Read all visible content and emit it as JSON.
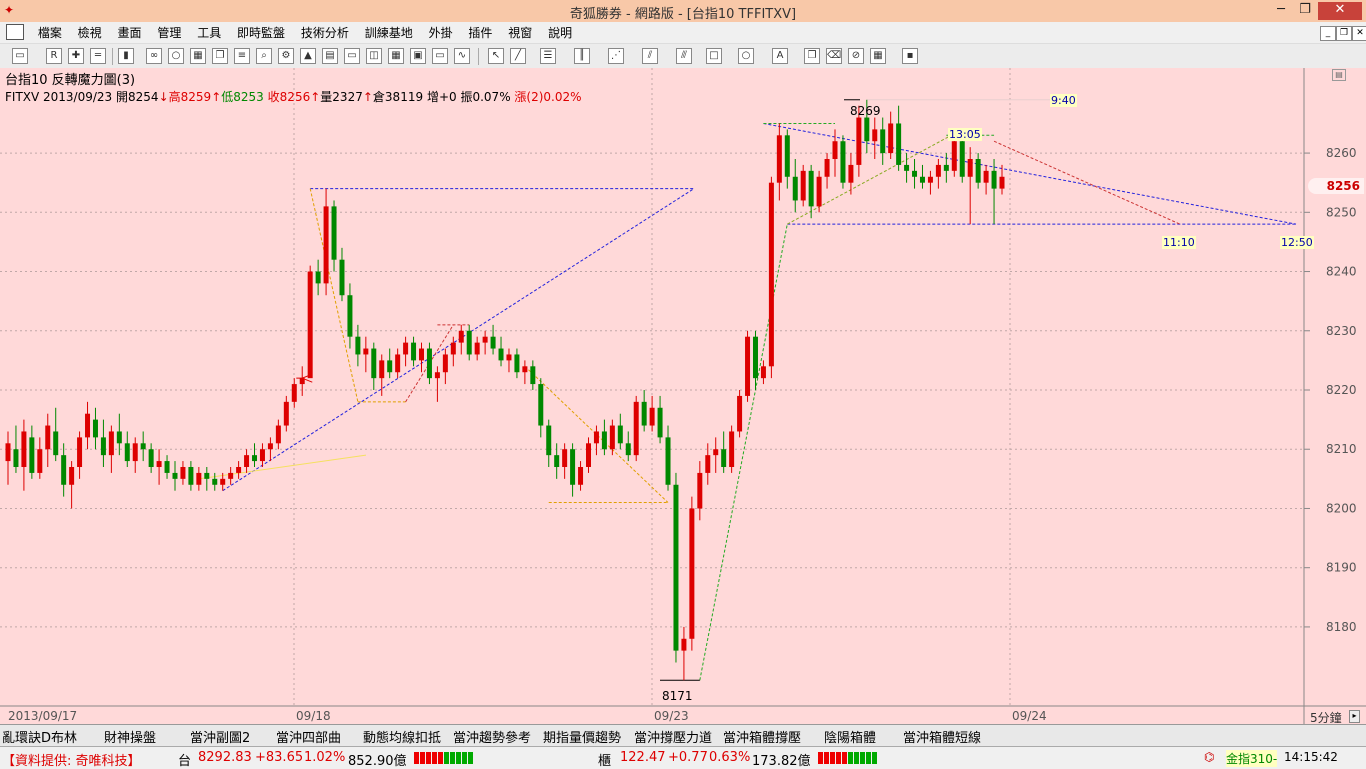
{
  "window": {
    "title": "奇狐勝券 - 網路版 - [台指10 TFFITXV]"
  },
  "menu": [
    "檔案",
    "檢視",
    "畫面",
    "管理",
    "工具",
    "即時監盤",
    "技術分析",
    "訓練基地",
    "外掛",
    "插件",
    "視窗",
    "說明"
  ],
  "chart": {
    "title": "台指10 反轉魔力圖(3)",
    "info": {
      "symbol_date": "FITXV 2013/09/23",
      "open_label": "開",
      "open": "8254",
      "high_label": "高",
      "high": "8259",
      "low_label": "低",
      "low": "8253",
      "close_label": "收",
      "close": "8256",
      "vol_label": "量",
      "vol": "2327",
      "oi_label": "倉",
      "oi": "38119",
      "inc": "增+0",
      "amp": "振0.07%",
      "chg_label": "漲(2)",
      "chg": "0.02%"
    },
    "price_tag": "8256",
    "period": "5分鐘",
    "marks": {
      "high": "8269",
      "low": "8171"
    },
    "time_labels": [
      "9:40",
      "13:05",
      "11:10",
      "12:50"
    ],
    "date_labels": [
      "2013/09/17",
      "09/18",
      "09/23",
      "09/24"
    ],
    "colors": {
      "background": "#ffd9d9",
      "up": "#dd0000",
      "down": "#008800"
    }
  },
  "chart_data": {
    "type": "candlestick",
    "title": "台指10 反轉魔力圖(3)",
    "period": "5分鐘",
    "ylim": [
      8168,
      8272
    ],
    "yticks": [
      8180,
      8190,
      8200,
      8210,
      8220,
      8230,
      8240,
      8250,
      8260
    ],
    "series": [
      {
        "ohlc": [
          [
            8208,
            8213,
            8204,
            8211
          ],
          [
            8210,
            8214,
            8206,
            8207
          ],
          [
            8207,
            8215,
            8203,
            8213
          ],
          [
            8212,
            8214,
            8205,
            8206
          ],
          [
            8206,
            8212,
            8205,
            8210
          ],
          [
            8210,
            8216,
            8207,
            8214
          ],
          [
            8213,
            8217,
            8208,
            8209
          ],
          [
            8209,
            8211,
            8202,
            8204
          ],
          [
            8204,
            8208,
            8200,
            8207
          ],
          [
            8207,
            8213,
            8205,
            8212
          ],
          [
            8212,
            8218,
            8210,
            8216
          ],
          [
            8215,
            8217,
            8210,
            8212
          ],
          [
            8212,
            8215,
            8207,
            8209
          ],
          [
            8209,
            8214,
            8206,
            8213
          ],
          [
            8213,
            8216,
            8209,
            8211
          ],
          [
            8211,
            8213,
            8207,
            8208
          ],
          [
            8208,
            8212,
            8206,
            8211
          ],
          [
            8211,
            8213,
            8208,
            8210
          ],
          [
            8210,
            8211,
            8206,
            8207
          ],
          [
            8207,
            8210,
            8204,
            8208
          ],
          [
            8208,
            8209,
            8205,
            8206
          ],
          [
            8206,
            8208,
            8203,
            8205
          ],
          [
            8205,
            8208,
            8204,
            8207
          ],
          [
            8207,
            8208,
            8203,
            8204
          ],
          [
            8204,
            8207,
            8203,
            8206
          ],
          [
            8206,
            8207,
            8203,
            8205
          ],
          [
            8205,
            8206,
            8203,
            8204
          ],
          [
            8204,
            8206,
            8203,
            8205
          ],
          [
            8205,
            8207,
            8204,
            8206
          ],
          [
            8206,
            8208,
            8205,
            8207
          ],
          [
            8207,
            8210,
            8206,
            8209
          ],
          [
            8209,
            8211,
            8207,
            8208
          ],
          [
            8208,
            8211,
            8207,
            8210
          ],
          [
            8210,
            8212,
            8208,
            8211
          ],
          [
            8211,
            8215,
            8210,
            8214
          ],
          [
            8214,
            8219,
            8213,
            8218
          ],
          [
            8218,
            8222,
            8217,
            8221
          ],
          [
            8221,
            8224,
            8219,
            8222
          ],
          [
            8222,
            8241,
            8233,
            8240
          ],
          [
            8240,
            8242,
            8236,
            8238
          ],
          [
            8238,
            8254,
            8236,
            8251
          ],
          [
            8251,
            8252,
            8240,
            8242
          ],
          [
            8242,
            8244,
            8235,
            8236
          ],
          [
            8236,
            8238,
            8227,
            8229
          ],
          [
            8229,
            8231,
            8224,
            8226
          ],
          [
            8226,
            8229,
            8223,
            8227
          ],
          [
            8227,
            8228,
            8220,
            8222
          ],
          [
            8222,
            8226,
            8219,
            8225
          ],
          [
            8225,
            8227,
            8222,
            8223
          ],
          [
            8223,
            8227,
            8222,
            8226
          ],
          [
            8226,
            8229,
            8224,
            8228
          ],
          [
            8228,
            8229,
            8224,
            8225
          ],
          [
            8225,
            8228,
            8223,
            8227
          ],
          [
            8227,
            8228,
            8221,
            8222
          ],
          [
            8222,
            8224,
            8218,
            8223
          ],
          [
            8223,
            8227,
            8221,
            8226
          ],
          [
            8226,
            8229,
            8224,
            8228
          ],
          [
            8228,
            8231,
            8226,
            8230
          ],
          [
            8230,
            8231,
            8225,
            8226
          ],
          [
            8226,
            8229,
            8225,
            8228
          ],
          [
            8228,
            8230,
            8226,
            8229
          ],
          [
            8229,
            8231,
            8226,
            8227
          ],
          [
            8227,
            8229,
            8224,
            8225
          ],
          [
            8225,
            8227,
            8223,
            8226
          ],
          [
            8226,
            8227,
            8222,
            8223
          ],
          [
            8223,
            8225,
            8221,
            8224
          ],
          [
            8224,
            8225,
            8220,
            8221
          ],
          [
            8221,
            8222,
            8212,
            8214
          ],
          [
            8214,
            8215,
            8207,
            8209
          ],
          [
            8209,
            8211,
            8205,
            8207
          ],
          [
            8207,
            8211,
            8205,
            8210
          ],
          [
            8210,
            8211,
            8202,
            8204
          ],
          [
            8204,
            8208,
            8203,
            8207
          ],
          [
            8207,
            8212,
            8206,
            8211
          ],
          [
            8211,
            8214,
            8209,
            8213
          ],
          [
            8213,
            8215,
            8209,
            8210
          ],
          [
            8210,
            8215,
            8209,
            8214
          ],
          [
            8214,
            8216,
            8210,
            8211
          ],
          [
            8211,
            8213,
            8208,
            8209
          ],
          [
            8209,
            8219,
            8208,
            8218
          ],
          [
            8218,
            8220,
            8213,
            8214
          ],
          [
            8214,
            8219,
            8213,
            8217
          ],
          [
            8217,
            8219,
            8211,
            8212
          ],
          [
            8212,
            8214,
            8203,
            8204
          ],
          [
            8204,
            8206,
            8174,
            8176
          ],
          [
            8176,
            8180,
            8171,
            8178
          ],
          [
            8178,
            8202,
            8176,
            8200
          ],
          [
            8200,
            8208,
            8198,
            8206
          ],
          [
            8206,
            8211,
            8204,
            8209
          ],
          [
            8209,
            8212,
            8206,
            8210
          ],
          [
            8210,
            8213,
            8206,
            8207
          ],
          [
            8207,
            8214,
            8206,
            8213
          ],
          [
            8213,
            8220,
            8212,
            8219
          ],
          [
            8219,
            8230,
            8218,
            8229
          ],
          [
            8229,
            8230,
            8220,
            8222
          ],
          [
            8222,
            8225,
            8221,
            8224
          ],
          [
            8224,
            8256,
            8222,
            8255
          ],
          [
            8255,
            8265,
            8252,
            8263
          ],
          [
            8263,
            8264,
            8254,
            8256
          ],
          [
            8256,
            8259,
            8250,
            8252
          ],
          [
            8252,
            8258,
            8251,
            8257
          ],
          [
            8257,
            8258,
            8249,
            8251
          ],
          [
            8251,
            8257,
            8250,
            8256
          ],
          [
            8256,
            8260,
            8254,
            8259
          ],
          [
            8259,
            8264,
            8256,
            8262
          ],
          [
            8262,
            8263,
            8254,
            8255
          ],
          [
            8255,
            8260,
            8253,
            8258
          ],
          [
            8258,
            8268,
            8256,
            8266
          ],
          [
            8266,
            8269,
            8260,
            8262
          ],
          [
            8262,
            8266,
            8259,
            8264
          ],
          [
            8264,
            8266,
            8258,
            8260
          ],
          [
            8260,
            8267,
            8259,
            8265
          ],
          [
            8265,
            8268,
            8257,
            8258
          ],
          [
            8258,
            8260,
            8255,
            8257
          ],
          [
            8257,
            8259,
            8254,
            8256
          ],
          [
            8256,
            8258,
            8254,
            8255
          ],
          [
            8255,
            8257,
            8253,
            8256
          ],
          [
            8256,
            8259,
            8254,
            8258
          ],
          [
            8258,
            8260,
            8255,
            8257
          ],
          [
            8257,
            8264,
            8256,
            8262
          ],
          [
            8262,
            8263,
            8255,
            8256
          ],
          [
            8256,
            8261,
            8248,
            8259
          ],
          [
            8259,
            8260,
            8254,
            8255
          ],
          [
            8255,
            8258,
            8253,
            8257
          ],
          [
            8257,
            8259,
            8248,
            8254
          ],
          [
            8254,
            8258,
            8253,
            8256
          ]
        ]
      }
    ]
  },
  "tabs": [
    "亂環訣D布林",
    "財神操盤",
    "當沖副圖2",
    "當沖四部曲",
    "動態均線扣抵",
    "當沖趨勢參考",
    "期指量價趨勢",
    "當沖撐壓力道",
    "當沖箱體撐壓",
    "陰陽箱體",
    "當沖箱體短線"
  ],
  "status": {
    "provider": "【資料提供: 奇唯科技】",
    "tw_label": "台",
    "tw_index": "8292.83",
    "tw_chg": "+83.65",
    "tw_pct": "1.02%",
    "tw_amt": "852.90億",
    "otc_label": "櫃",
    "otc_index": "122.47",
    "otc_chg": "+0.77",
    "otc_pct": "0.63%",
    "otc_amt": "173.82億",
    "quote": "金指310-",
    "time": "14:15:42"
  }
}
